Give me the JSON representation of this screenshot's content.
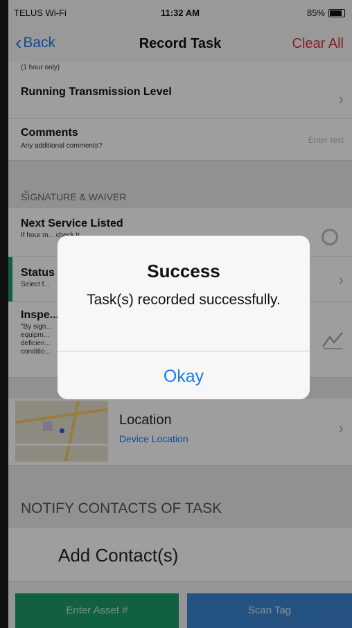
{
  "status_bar": {
    "carrier": "TELUS Wi-Fi",
    "time": "11:32 AM",
    "battery": "85%"
  },
  "nav": {
    "back_label": "Back",
    "title": "Record Task",
    "clear_label": "Clear All"
  },
  "rows": {
    "top_partial": "(1 hour only)",
    "transmission_label": "Running Transmission Level",
    "comments_label": "Comments",
    "comments_sub": "Any additional comments?",
    "comments_placeholder": "Enter text"
  },
  "signature_section": {
    "header": "SIGNATURE & WAIVER",
    "next_service_label": "Next Service Listed",
    "next_service_sub": "If hour m... check tr...",
    "status_label": "Status",
    "status_sub": "Select f...",
    "inspection_label": "Inspe...",
    "inspection_sub": "\"By sign... equipm... deficien... conditio..."
  },
  "location": {
    "label": "Location",
    "value": "Device Location"
  },
  "notify": {
    "header": "NOTIFY CONTACTS OF TASK",
    "add_label": "Add Contact(s)"
  },
  "bottom": {
    "enter_asset": "Enter Asset #",
    "scan_tag": "Scan Tag"
  },
  "alert": {
    "title": "Success",
    "message": "Task(s) recorded successfully.",
    "button": "Okay"
  },
  "colors": {
    "ios_blue": "#1d7af3",
    "clear_red": "#e02d39",
    "asset_green": "#1a9c6a",
    "scan_blue": "#3d86d1"
  }
}
